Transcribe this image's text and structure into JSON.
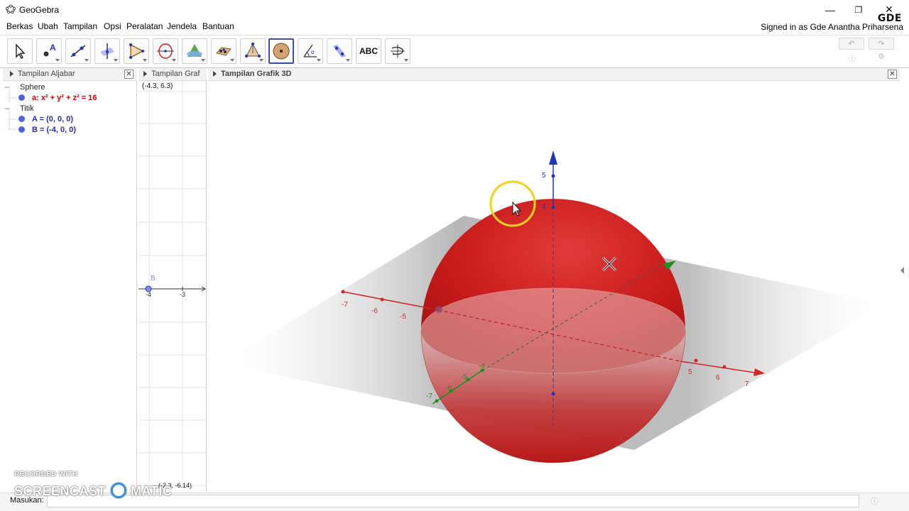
{
  "window": {
    "title": "GeoGebra",
    "min_icon": "minimize-icon",
    "max_icon": "restore-icon",
    "close_icon": "close-icon"
  },
  "menu": [
    "Berkas",
    "Ubah",
    "Tampilan",
    "Opsi",
    "Peralatan",
    "Jendela",
    "Bantuan"
  ],
  "account": {
    "signed_in": "Signed in as Gde Anantha Priharsena",
    "logo": "GDE"
  },
  "toolbar": {
    "tools": [
      "move-tool-icon",
      "point-tool-icon",
      "line-tool-icon",
      "perpendicular-line-tool-icon",
      "polygon-tool-icon",
      "circle-axis-tool-icon",
      "intersect-surfaces-tool-icon",
      "plane-tool-icon",
      "pyramid-tool-icon",
      "sphere-tool-icon",
      "angle-tool-icon",
      "reflect-tool-icon",
      "text-tool-icon",
      "rotate-view-tool-icon"
    ],
    "text_tool_label": "ABC",
    "active_tool": "sphere-tool-icon"
  },
  "panels": {
    "algebra": {
      "title": "Tampilan Aljabar"
    },
    "graphics2d": {
      "title": "Tampilan Graf",
      "top_coords": "(-4.3, 6.3)",
      "bottom_coords": "(-2.3, -6.14)",
      "point_label": "B",
      "tick_a": "-4",
      "tick_b": "-3"
    },
    "graphics3d": {
      "title": "Tampilan Grafik 3D"
    }
  },
  "algebra": {
    "groups": [
      {
        "name": "Sphere",
        "items": [
          {
            "text": "a: x² + y² + z² = 16",
            "color": "#cc0000"
          }
        ]
      },
      {
        "name": "Titik",
        "items": [
          {
            "text": "A = (0, 0, 0)",
            "color": "#2a2aa8"
          },
          {
            "text": "B = (-4, 0, 0)",
            "color": "#2a2aa8"
          }
        ]
      }
    ]
  },
  "scene3d": {
    "x_axis_labels": [
      "-7",
      "-6",
      "-5",
      "5",
      "6",
      "7"
    ],
    "z_axis_labels": [
      "5",
      "4"
    ],
    "y_axis_labels": [
      "-4",
      "-6",
      "-7",
      "-5"
    ],
    "sphere_color": "#c81b1b"
  },
  "inputbar": {
    "label": "Masukan:"
  },
  "watermark": {
    "top": "RECORDED WITH",
    "main_left": "SCREENCAST",
    "main_right": "MATIC"
  },
  "colors": {
    "accent": "#3c4f9a",
    "sphere": "#c81b1b",
    "x_axis": "#d42424",
    "y_axis": "#1f8f1f",
    "z_axis": "#2233bb"
  }
}
